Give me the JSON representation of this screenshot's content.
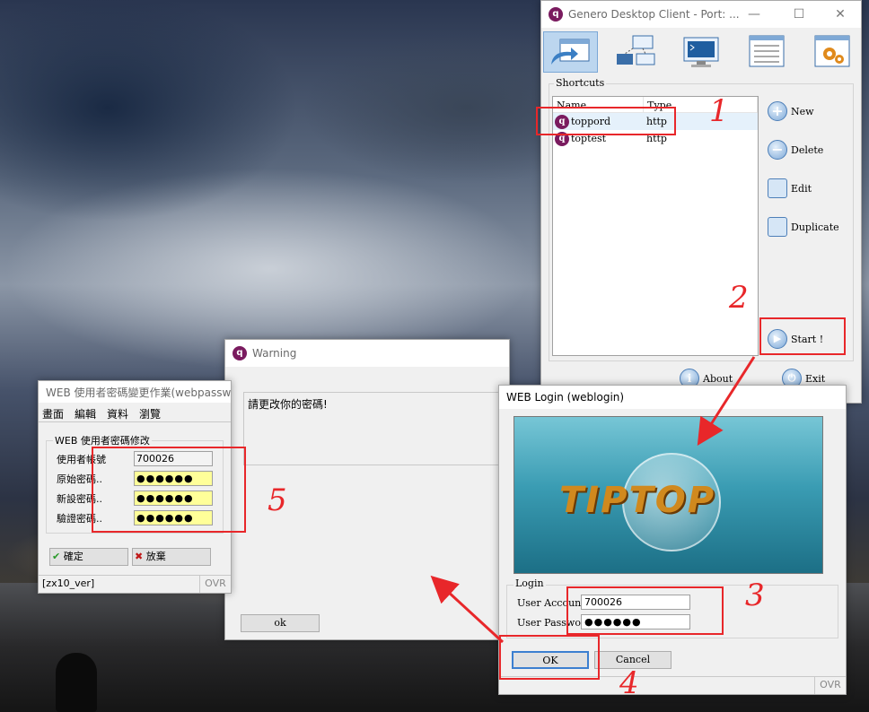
{
  "genero": {
    "title": "Genero Desktop Client - Port: ...",
    "controls": [
      "—",
      "☐",
      "✕"
    ],
    "shortcuts_label": "Shortcuts",
    "columns": [
      "Name",
      "Type"
    ],
    "rows": [
      {
        "name": "toppord",
        "type": "http"
      },
      {
        "name": "toptest",
        "type": "http"
      }
    ],
    "buttons": {
      "new": "New",
      "delete": "Delete",
      "edit": "Edit",
      "duplicate": "Duplicate",
      "start": "Start !",
      "about": "About",
      "exit": "Exit"
    }
  },
  "warning": {
    "title": "Warning",
    "message": "請更改你的密碼!",
    "ok": "ok"
  },
  "webpass": {
    "title": "WEB 使用者密碼變更作業(webpassw...",
    "menu": [
      "畫面",
      "編輯",
      "資料",
      "瀏覽"
    ],
    "group_label": "WEB 使用者密碼修改",
    "fields": [
      {
        "label": "使用者帳號",
        "value": "700026"
      },
      {
        "label": "原始密碼..",
        "value": "●●●●●●"
      },
      {
        "label": "新設密碼..",
        "value": "●●●●●●"
      },
      {
        "label": "驗證密碼..",
        "value": "●●●●●●"
      }
    ],
    "confirm": "確定",
    "cancel": "放棄",
    "status_left": "[zx10_ver]",
    "status_right": "OVR"
  },
  "weblogin": {
    "title": "WEB Login (weblogin)",
    "banner_text": "TIPTOP",
    "login_label": "Login",
    "account_label": "User Account",
    "account_value": "700026",
    "password_label": "User Password",
    "password_value": "●●●●●●",
    "ok": "OK",
    "cancel": "Cancel",
    "status_right": "OVR"
  },
  "annotations": [
    "1",
    "2",
    "3",
    "4",
    "5"
  ],
  "colors": {
    "annotation": "#e8272a",
    "selection": "#e5f1fb",
    "password_bg": "#ffff99"
  }
}
